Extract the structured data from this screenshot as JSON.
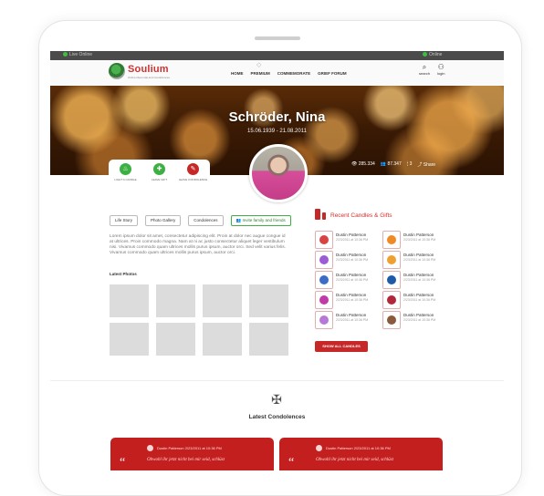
{
  "topbar": {
    "left_text": "Live Online",
    "right_text": "Online"
  },
  "brand": {
    "name": "Soulium",
    "tagline": "Online Memorial and Condolences"
  },
  "menu": [
    "HOME",
    "PREMIUM",
    "COMMEMORATE",
    "GRIEF FORUM"
  ],
  "nav_icons": [
    {
      "label": "search",
      "icon": "search-icon"
    },
    {
      "label": "login",
      "icon": "user-icon"
    }
  ],
  "hero": {
    "name": "Schröder, Nina",
    "dates": "15.06.1939 - 21.08.2011"
  },
  "stats": {
    "views": "285.334",
    "followers": "87.347",
    "candles": "3",
    "share": "Share"
  },
  "actions": [
    {
      "label": "LIGHT A CANDLE",
      "color": "#3cb043"
    },
    {
      "label": "LEAVE GIFT",
      "color": "#3cb043"
    },
    {
      "label": "LEAVE CONDOLENCE",
      "color": "#c62828"
    }
  ],
  "tabs": [
    "Life Story",
    "Photo Gallery",
    "Condolences",
    "Invite family and friends"
  ],
  "story_text": "Lorem ipsum dolor sit amet, consectetur adipiscing elit. Proin at dolor nec augue congue id at ultrices. Proin commodo magna. Nam at ni ac justo consectetur aliquet leger vestibulum nisi. Vivamus commodo quam ultrices mollis purus ipsum, auctor orci. Sed velit varius felis. Vivamus commodo quam ultrices mollis purus ipsum, auctor orci.",
  "latest_photos_label": "Latest Photos",
  "candles": {
    "title": "Recent Candles  & Gifts",
    "items": [
      {
        "name": "Dustin Patterson",
        "date": "2/23/2011 at 10:36 PM",
        "color": "#d84343"
      },
      {
        "name": "Dustin Patterson",
        "date": "2/23/2011 at 10:36 PM",
        "color": "#f08a24"
      },
      {
        "name": "Dustin Patterson",
        "date": "2/23/2011 at 10:36 PM",
        "color": "#9b5cd6"
      },
      {
        "name": "Dustin Patterson",
        "date": "2/23/2011 at 10:36 PM",
        "color": "#f0a030"
      },
      {
        "name": "Dustin Patterson",
        "date": "2/23/2011 at 10:36 PM",
        "color": "#3d6cc6"
      },
      {
        "name": "Dustin Patterson",
        "date": "2/23/2011 at 10:36 PM",
        "color": "#1f5aa8"
      },
      {
        "name": "Dustin Patterson",
        "date": "2/23/2011 at 10:36 PM",
        "color": "#c23aa8"
      },
      {
        "name": "Dustin Patterson",
        "date": "2/23/2011 at 10:36 PM",
        "color": "#b0283a"
      },
      {
        "name": "Dustin Patterson",
        "date": "2/23/2011 at 10:36 PM",
        "color": "#b779d9"
      },
      {
        "name": "Dustin Patterson",
        "date": "2/23/2011 at 10:36 PM",
        "color": "#8a5a3a"
      }
    ],
    "show_all": "SHOW ALL CANDLES"
  },
  "condolences": {
    "title": "Latest Condolences",
    "cards": [
      {
        "name": "Dustin Patterson",
        "date": "2/23/2011 at 10:36 PM",
        "text": "Obwohl ihr jetzt nicht bei mir seid, schlüst"
      },
      {
        "name": "Dustin Patterson",
        "date": "2/23/2011 at 10:36 PM",
        "text": "Obwohl ihr jetzt nicht bei mir seid, schlüst"
      }
    ]
  }
}
